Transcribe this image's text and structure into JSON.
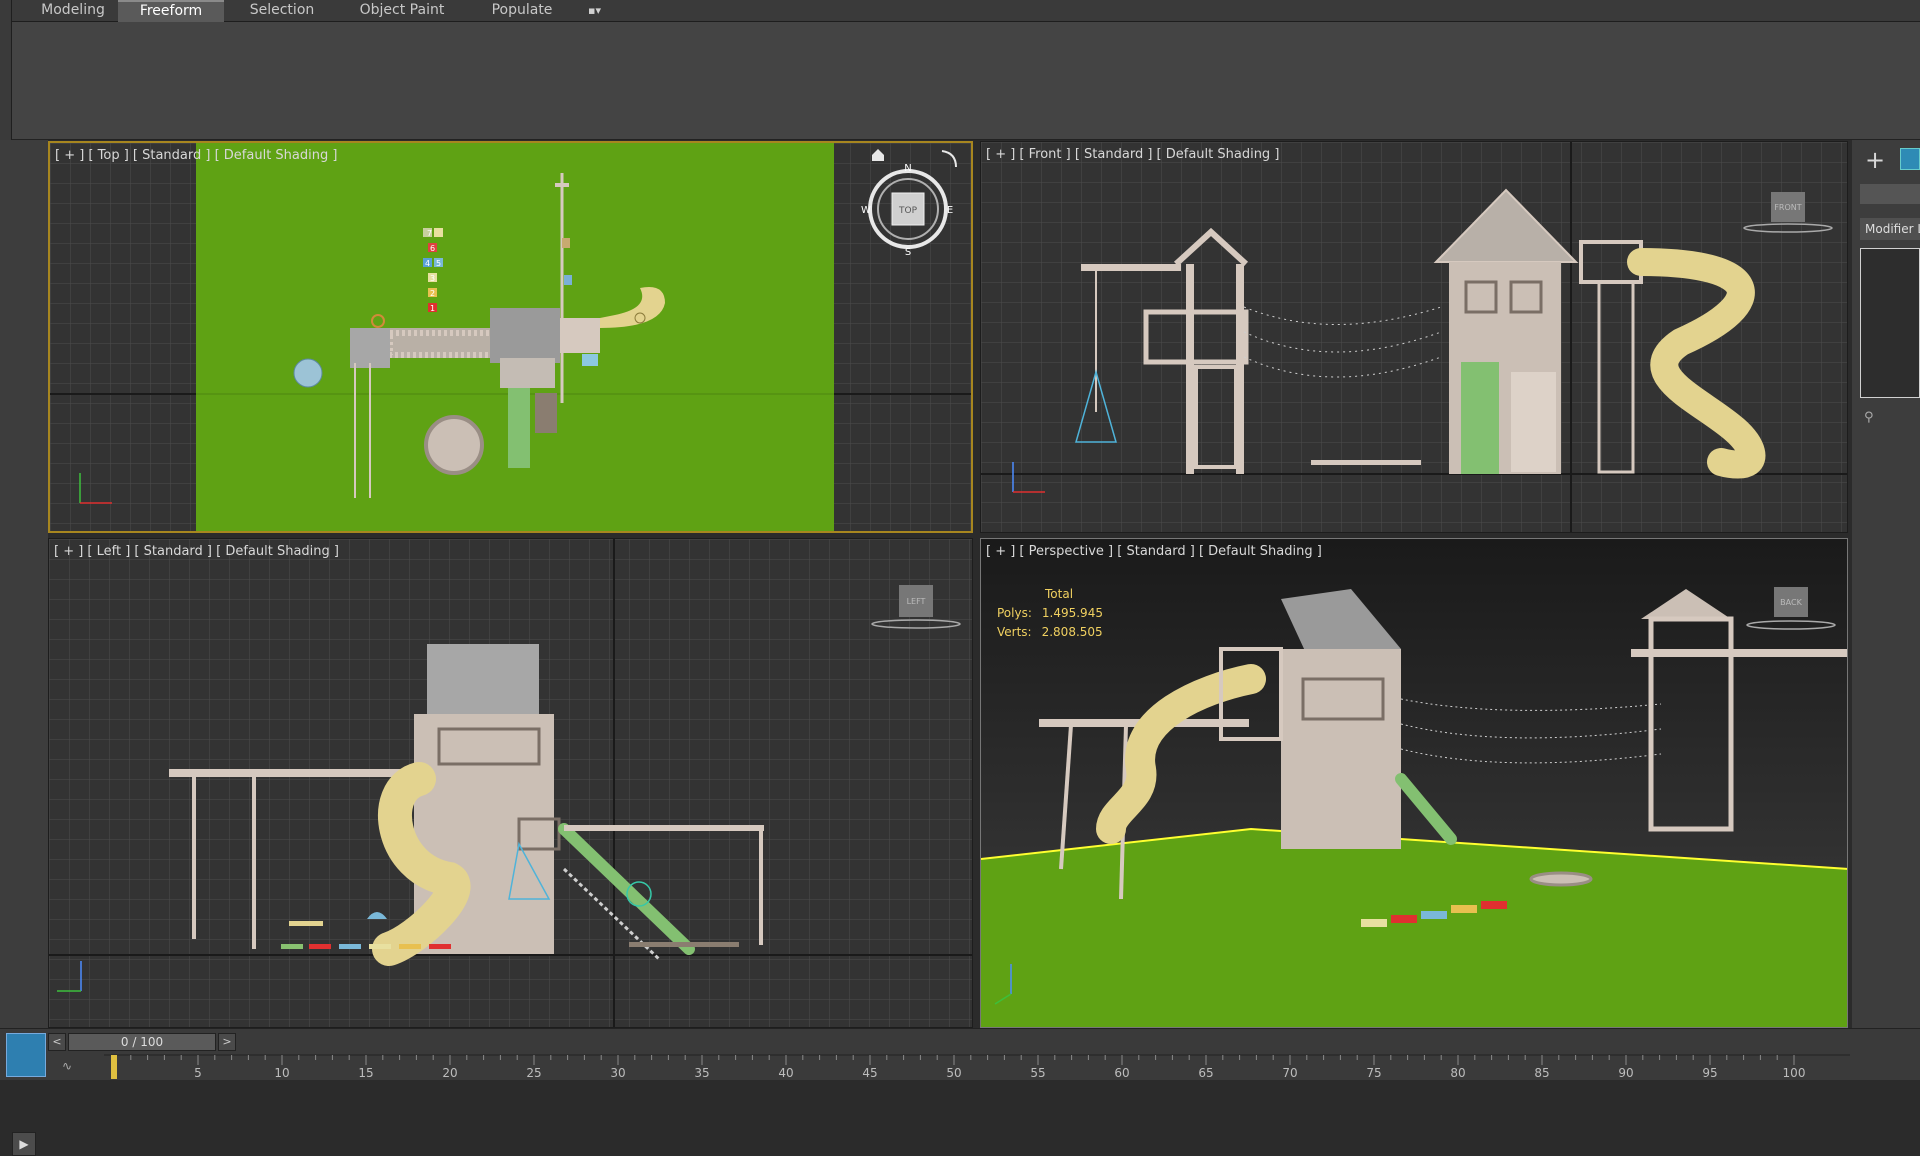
{
  "ribbon": {
    "tabs": [
      {
        "label": "Modeling",
        "active": false
      },
      {
        "label": "Freeform",
        "active": true
      },
      {
        "label": "Selection",
        "active": false
      },
      {
        "label": "Object Paint",
        "active": false
      },
      {
        "label": "Populate",
        "active": false
      }
    ],
    "extra_icon": "camera-dropdown-icon",
    "extra_glyph": "▪▾"
  },
  "right_panel": {
    "create_glyph": "+",
    "modifier_label": "Modifier Li",
    "pin_glyph": "⚲"
  },
  "viewports": {
    "top": {
      "label": "[ + ] [ Top ] [ Standard ] [ Default Shading ]",
      "viewcube": "TOP",
      "compass": {
        "n": "N",
        "s": "S",
        "e": "E",
        "w": "W"
      }
    },
    "front": {
      "label": "[ + ] [ Front ] [ Standard ] [ Default Shading ]",
      "viewcube": "FRONT"
    },
    "left": {
      "label": "[ + ] [ Left ] [ Standard ] [ Default Shading ]",
      "viewcube": "LEFT"
    },
    "perspective": {
      "label": "[ + ] [ Perspective ] [ Standard ] [ Default Shading ]",
      "viewcube": "BACK",
      "stats": {
        "title": "Total",
        "polys_label": "Polys:",
        "polys": "1.495.945",
        "verts_label": "Verts:",
        "verts": "2.808.505"
      }
    }
  },
  "hopscotch_numbers": [
    "7",
    "6",
    "4",
    "5",
    "3",
    "2",
    "1"
  ],
  "timeline": {
    "prev": "<",
    "next": ">",
    "frame": "0 / 100",
    "curve_glyph": "∿",
    "ticks": [
      5,
      10,
      15,
      20,
      25,
      30,
      35,
      40,
      45,
      50,
      55,
      60,
      65,
      70,
      75,
      80,
      85,
      90,
      95,
      100
    ],
    "max_frame": 100
  },
  "colors": {
    "active_viewport": "#a7861f",
    "ground": "#5fa214",
    "wood": "#d6c9bf",
    "slide": "#e3d38f",
    "roof": "#9a9a9a",
    "accent": "#2e7fb0",
    "stats_text": "#f0d060"
  }
}
